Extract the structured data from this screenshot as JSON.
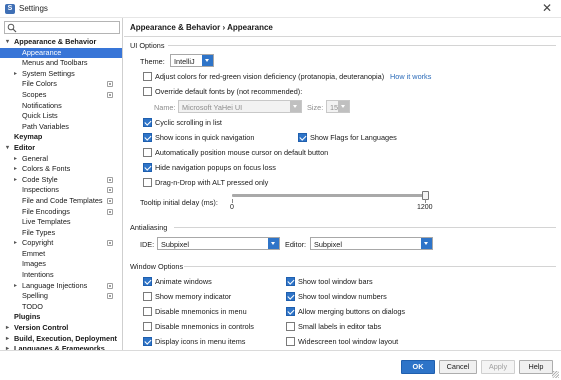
{
  "window": {
    "title": "Settings",
    "close_glyph": "✕"
  },
  "search": {
    "placeholder": "",
    "value": ""
  },
  "sidebar": {
    "items": [
      {
        "label": "Appearance & Behavior",
        "level": 0,
        "bold": true,
        "expanded": true
      },
      {
        "label": "Appearance",
        "level": 1,
        "selected": true
      },
      {
        "label": "Menus and Toolbars",
        "level": 1
      },
      {
        "label": "System Settings",
        "level": 1,
        "collapsed": true
      },
      {
        "label": "File Colors",
        "level": 1,
        "project": true
      },
      {
        "label": "Scopes",
        "level": 1,
        "project": true
      },
      {
        "label": "Notifications",
        "level": 1
      },
      {
        "label": "Quick Lists",
        "level": 1
      },
      {
        "label": "Path Variables",
        "level": 1
      },
      {
        "label": "Keymap",
        "level": 0,
        "bold": true
      },
      {
        "label": "Editor",
        "level": 0,
        "bold": true,
        "expanded": true
      },
      {
        "label": "General",
        "level": 1,
        "collapsed": true
      },
      {
        "label": "Colors & Fonts",
        "level": 1,
        "collapsed": true
      },
      {
        "label": "Code Style",
        "level": 1,
        "collapsed": true,
        "project": true
      },
      {
        "label": "Inspections",
        "level": 1,
        "project": true
      },
      {
        "label": "File and Code Templates",
        "level": 1,
        "project": true
      },
      {
        "label": "File Encodings",
        "level": 1,
        "project": true
      },
      {
        "label": "Live Templates",
        "level": 1
      },
      {
        "label": "File Types",
        "level": 1
      },
      {
        "label": "Copyright",
        "level": 1,
        "collapsed": true,
        "project": true
      },
      {
        "label": "Emmet",
        "level": 1
      },
      {
        "label": "Images",
        "level": 1
      },
      {
        "label": "Intentions",
        "level": 1
      },
      {
        "label": "Language Injections",
        "level": 1,
        "collapsed": true,
        "project": true
      },
      {
        "label": "Spelling",
        "level": 1,
        "project": true
      },
      {
        "label": "TODO",
        "level": 1
      },
      {
        "label": "Plugins",
        "level": 0,
        "bold": true
      },
      {
        "label": "Version Control",
        "level": 0,
        "bold": true,
        "collapsed": true
      },
      {
        "label": "Build, Execution, Deployment",
        "level": 0,
        "bold": true,
        "collapsed": true
      },
      {
        "label": "Languages & Frameworks",
        "level": 0,
        "bold": true,
        "collapsed": true
      }
    ]
  },
  "content": {
    "breadcrumb": "Appearance & Behavior › Appearance",
    "ui_options": {
      "title": "UI Options",
      "theme_label": "Theme:",
      "theme_value": "IntelliJ",
      "adjust_colors": {
        "label": "Adjust colors for red-green vision deficiency (protanopia, deuteranopia)",
        "checked": false,
        "link": "How it works"
      },
      "override_fonts": {
        "label": "Override default fonts by (not recommended):",
        "checked": false
      },
      "font_name_label": "Name:",
      "font_name_value": "Microsoft YaHei UI",
      "font_size_label": "Size:",
      "font_size_value": "15",
      "cyclic_scrolling": {
        "label": "Cyclic scrolling in list",
        "checked": true
      },
      "show_icons": {
        "label": "Show icons in quick navigation",
        "checked": true
      },
      "show_flags": {
        "label": "Show Flags for Languages",
        "checked": true
      },
      "auto_mouse": {
        "label": "Automatically position mouse cursor on default button",
        "checked": false
      },
      "hide_popups": {
        "label": "Hide navigation popups on focus loss",
        "checked": true
      },
      "drag_drop": {
        "label": "Drag-n-Drop with ALT pressed only",
        "checked": false
      },
      "tooltip_label": "Tooltip initial delay (ms):",
      "tooltip_min": "0",
      "tooltip_max": "1200",
      "tooltip_value_fraction": 1.0
    },
    "antialiasing": {
      "title": "Antialiasing",
      "ide_label": "IDE:",
      "ide_value": "Subpixel",
      "editor_label": "Editor:",
      "editor_value": "Subpixel"
    },
    "window_options": {
      "title": "Window Options",
      "left": [
        {
          "label": "Animate windows",
          "checked": true
        },
        {
          "label": "Show memory indicator",
          "checked": false
        },
        {
          "label": "Disable mnemonics in menu",
          "checked": false
        },
        {
          "label": "Disable mnemonics in controls",
          "checked": false
        },
        {
          "label": "Display icons in menu items",
          "checked": true
        }
      ],
      "right": [
        {
          "label": "Show tool window bars",
          "checked": true
        },
        {
          "label": "Show tool window numbers",
          "checked": true
        },
        {
          "label": "Allow merging buttons on dialogs",
          "checked": true
        },
        {
          "label": "Small labels in editor tabs",
          "checked": false
        },
        {
          "label": "Widescreen tool window layout",
          "checked": false
        }
      ]
    }
  },
  "footer": {
    "ok": "OK",
    "cancel": "Cancel",
    "apply": "Apply",
    "help": "Help"
  },
  "colors": {
    "accent": "#2e74c8",
    "selection": "#3875d7",
    "link": "#2a6ab8"
  }
}
